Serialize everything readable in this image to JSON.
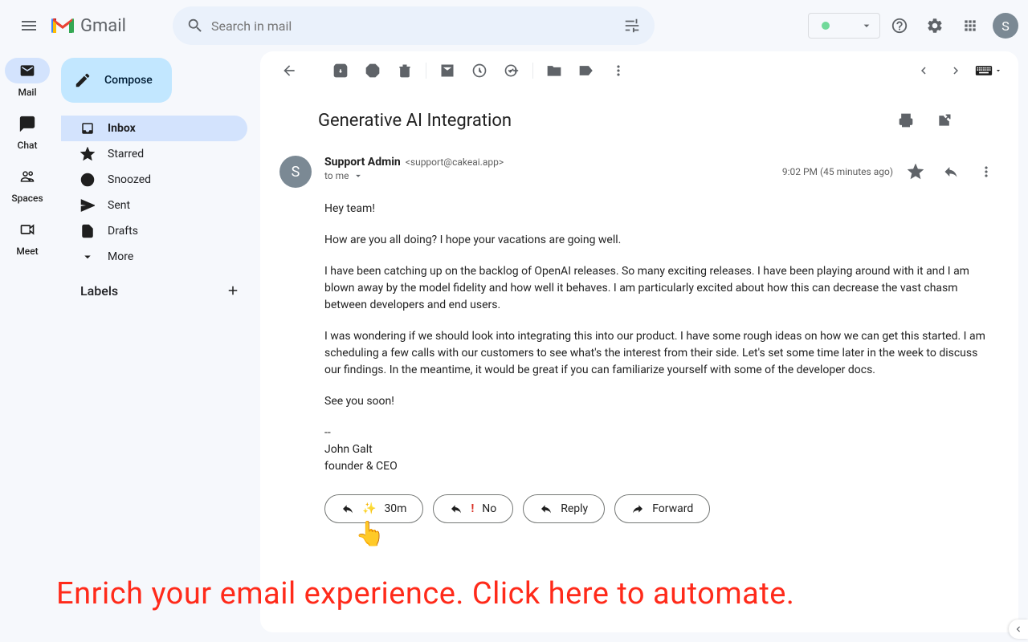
{
  "app": {
    "name": "Gmail"
  },
  "search": {
    "placeholder": "Search in mail"
  },
  "avatar": {
    "initial": "S"
  },
  "rail": {
    "mail": "Mail",
    "chat": "Chat",
    "spaces": "Spaces",
    "meet": "Meet"
  },
  "sidebar": {
    "compose": "Compose",
    "inbox": "Inbox",
    "starred": "Starred",
    "snoozed": "Snoozed",
    "sent": "Sent",
    "drafts": "Drafts",
    "more": "More",
    "labels_header": "Labels"
  },
  "email": {
    "subject": "Generative AI Integration",
    "sender_name": "Support Admin",
    "sender_email": "<support@cakeai.app>",
    "to_line": "to me",
    "time": "9:02 PM (45 minutes ago)",
    "sender_initial": "S",
    "body": {
      "p1": "Hey team!",
      "p2": "How are you all doing? I hope your vacations are going well.",
      "p3": "I have been catching up on the backlog of OpenAI releases. So many exciting releases. I have been playing around with it and I am blown away by the model fidelity and how well it behaves. I am particularly excited about how this can decrease the vast chasm between developers and end users.",
      "p4": "I was wondering if we should look into integrating this into our product. I have some rough ideas on how we can get this started. I am scheduling a few calls with our customers to see what's the interest from their side. Let's set some time later in the week to discuss our findings. In the meantime, it would be great if you can familiarize yourself with some of the developer docs.",
      "p5": "See you soon!",
      "sig1": "--",
      "sig2": "John Galt",
      "sig3": "founder & CEO"
    }
  },
  "actions": {
    "thirty": "30m",
    "no": "No",
    "reply": "Reply",
    "forward": "Forward"
  },
  "promo": "Enrich your email experience. Click here to automate."
}
